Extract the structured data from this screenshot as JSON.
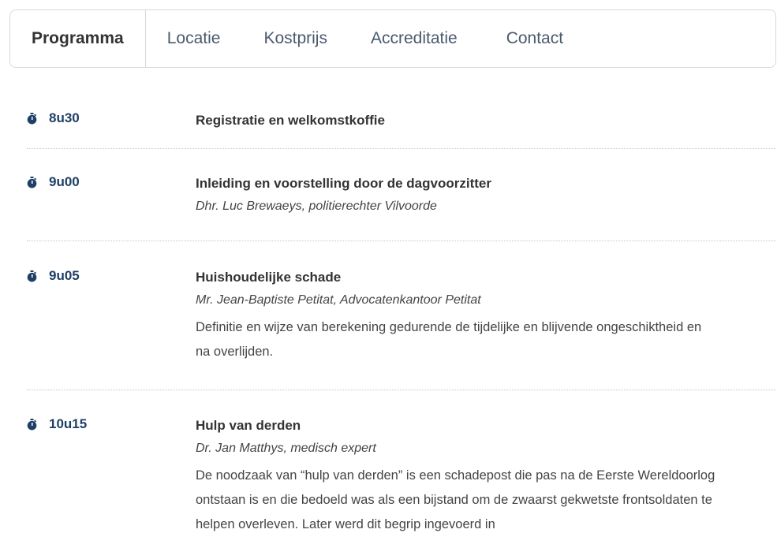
{
  "tabs": [
    "Programma",
    "Locatie",
    "Kostprijs",
    "Accreditatie",
    "Contact"
  ],
  "schedule": [
    {
      "time": "8u30",
      "title": "Registratie en welkomstkoffie",
      "speaker": "",
      "description": ""
    },
    {
      "time": "9u00",
      "title": "Inleiding en voorstelling door de dagvoorzitter",
      "speaker": "Dhr. Luc Brewaeys, politierechter Vilvoorde",
      "description": ""
    },
    {
      "time": "9u05",
      "title": "Huishoudelijke schade",
      "speaker": "Mr. Jean-Baptiste Petitat, Advocatenkantoor Petitat",
      "description": "Definitie en wijze van berekening gedurende de tijdelijke en blijvende ongeschiktheid en na overlijden."
    },
    {
      "time": "10u15",
      "title": "Hulp van derden",
      "speaker": "Dr. Jan Matthys, medisch expert",
      "description": "De noodzaak van “hulp van derden” is een schadepost die pas na de Eerste Wereldoorlog ontstaan is en die bedoeld was als een bijstand om de zwaarst gekwetste frontsoldaten te helpen overleven. Later werd dit begrip ingevoerd in"
    }
  ]
}
